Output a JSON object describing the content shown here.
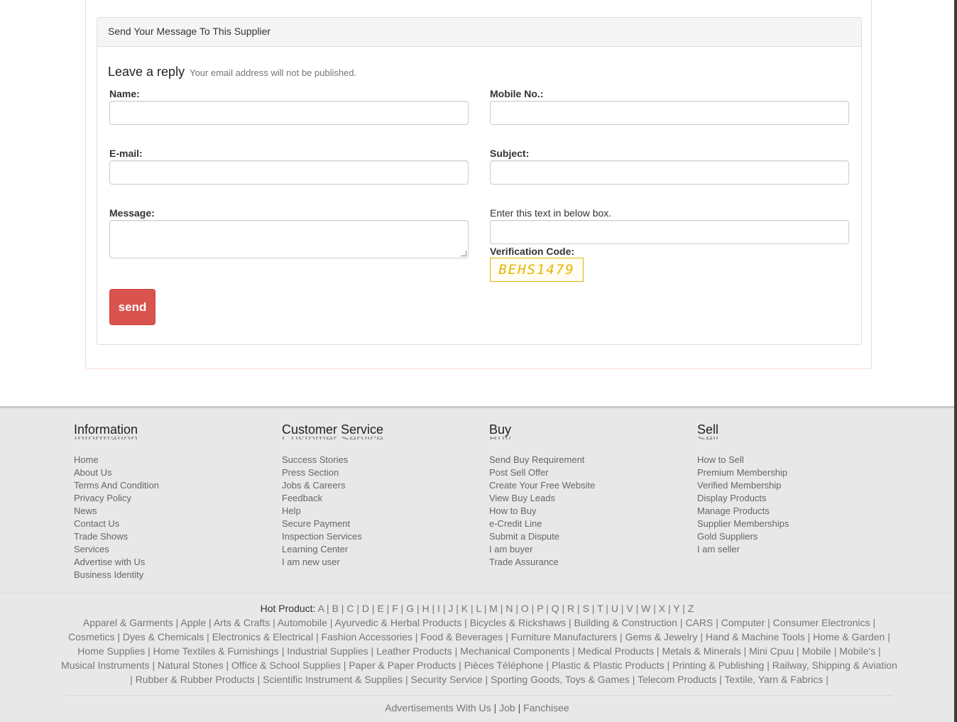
{
  "panel": {
    "heading": "Send Your Message To This Supplier",
    "reply_title": "Leave a reply",
    "reply_note": "Your email address will not be published."
  },
  "form": {
    "name_label": "Name:",
    "mobile_label": "Mobile No.:",
    "email_label": "E-mail:",
    "subject_label": "Subject:",
    "message_label": "Message:",
    "captcha_prompt": "Enter this text in below box.",
    "verification_label": "Verification Code:",
    "captcha_text": "BEHS1479",
    "send_label": "send"
  },
  "footer": {
    "columns": [
      {
        "title": "Information",
        "items": [
          "Home",
          "About Us",
          "Terms And Condition",
          "Privacy Policy",
          "News",
          "Contact Us",
          "Trade Shows",
          "Services",
          "Advertise with Us",
          "Business Identity"
        ]
      },
      {
        "title": "Customer Service",
        "items": [
          "Success Stories",
          "Press Section",
          "Jobs & Careers",
          "Feedback",
          "Help",
          "Secure Payment",
          "Inspection Services",
          "Learning Center",
          "I am new user"
        ]
      },
      {
        "title": "Buy",
        "items": [
          "Send Buy Requirement",
          "Post Sell Offer",
          "Create Your Free Website",
          "View Buy Leads",
          "How to Buy",
          "e-Credit Line",
          "Submit a Dispute",
          "I am buyer",
          "Trade Assurance"
        ]
      },
      {
        "title": "Sell",
        "items": [
          "How to Sell",
          "Premium Membership",
          "Verified Membership",
          "Display Products",
          "Manage Products",
          "Supplier Memberships",
          "Gold Suppliers",
          "I am seller"
        ]
      }
    ],
    "hot_product_label": "Hot Product:",
    "letters": [
      "A",
      "B",
      "C",
      "D",
      "E",
      "F",
      "G",
      "H",
      "I",
      "J",
      "K",
      "L",
      "M",
      "N",
      "O",
      "P",
      "Q",
      "R",
      "S",
      "T",
      "U",
      "V",
      "W",
      "X",
      "Y",
      "Z"
    ],
    "categories": [
      "Apparel & Garments",
      "Apple",
      "Arts & Crafts",
      "Automobile",
      "Ayurvedic & Herbal Products",
      "Bicycles & Rickshaws",
      "Building & Construction",
      "CARS",
      "Computer",
      "Consumer Electronics",
      "Cosmetics",
      "Dyes & Chemicals",
      "Electronics & Electrical",
      "Fashion Accessories",
      "Food & Beverages",
      "Furniture Manufacturers",
      "Gems & Jewelry",
      "Hand & Machine Tools",
      "Home & Garden",
      "Home Supplies",
      "Home Textiles & Furnishings",
      "Industrial Supplies",
      "Leather Products",
      "Mechanical Components",
      "Medical Products",
      "Metals & Minerals",
      "Mini Cpuu",
      "Mobile",
      "Mobile's",
      "Musical Instruments",
      "Natural Stones",
      "Office & School Supplies",
      "Paper & Paper Products",
      "Pièces Téléphone",
      "Plastic & Plastic Products",
      "Printing & Publishing",
      "Railway, Shipping & Aviation",
      "Rubber & Rubber Products",
      "Scientific Instrument & Supplies",
      "Security Service",
      "Sporting Goods, Toys & Games",
      "Telecom Products",
      "Textile, Yarn & Fabrics"
    ],
    "bottom_links": [
      "Advertisements With Us",
      "Job",
      "Fanchisee"
    ]
  }
}
